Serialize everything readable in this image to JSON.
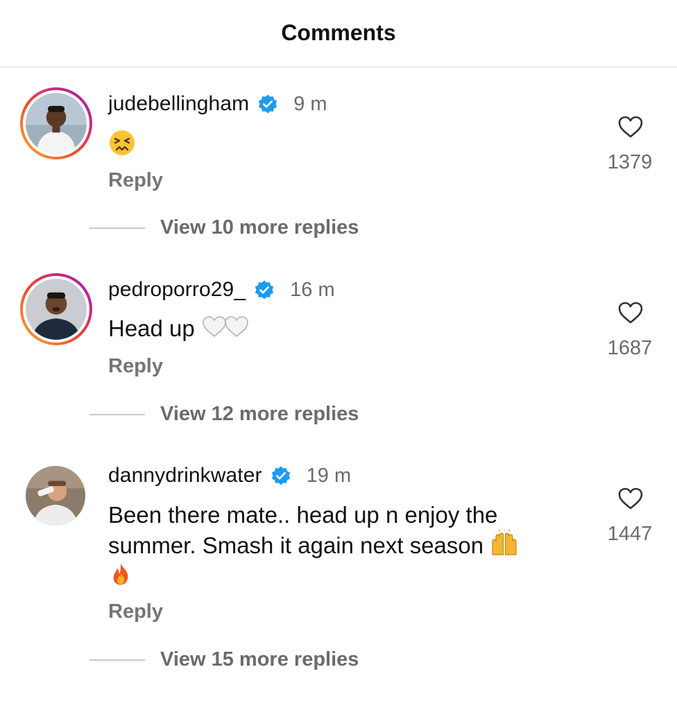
{
  "header": {
    "title": "Comments"
  },
  "comments": [
    {
      "username": "judebellingham",
      "time": "9 m",
      "text": "",
      "reply_label": "Reply",
      "likes": "1379",
      "view_replies": "View 10 more replies",
      "avatar_ring": "story",
      "icons": [
        "verified-icon",
        "persevering-face-emoji"
      ]
    },
    {
      "username": "pedroporro29_",
      "time": "16 m",
      "text": "Head up",
      "reply_label": "Reply",
      "likes": "1687",
      "view_replies": "View 12 more replies",
      "avatar_ring": "story",
      "icons": [
        "verified-icon",
        "white-heart-emoji",
        "white-heart-emoji"
      ]
    },
    {
      "username": "dannydrinkwater",
      "time": "19 m",
      "text_line1": "Been there mate.. head up n enjoy the",
      "text_line2": "summer. Smash it again next season",
      "reply_label": "Reply",
      "likes": "1447",
      "view_replies": "View 15 more replies",
      "avatar_ring": "none",
      "icons": [
        "verified-icon",
        "raising-hands-emoji",
        "fire-emoji"
      ]
    }
  ],
  "colors": {
    "text": "#111111",
    "muted": "#6b6b6b",
    "verified": "#1d9bf0",
    "divider": "#dbdbdb"
  }
}
